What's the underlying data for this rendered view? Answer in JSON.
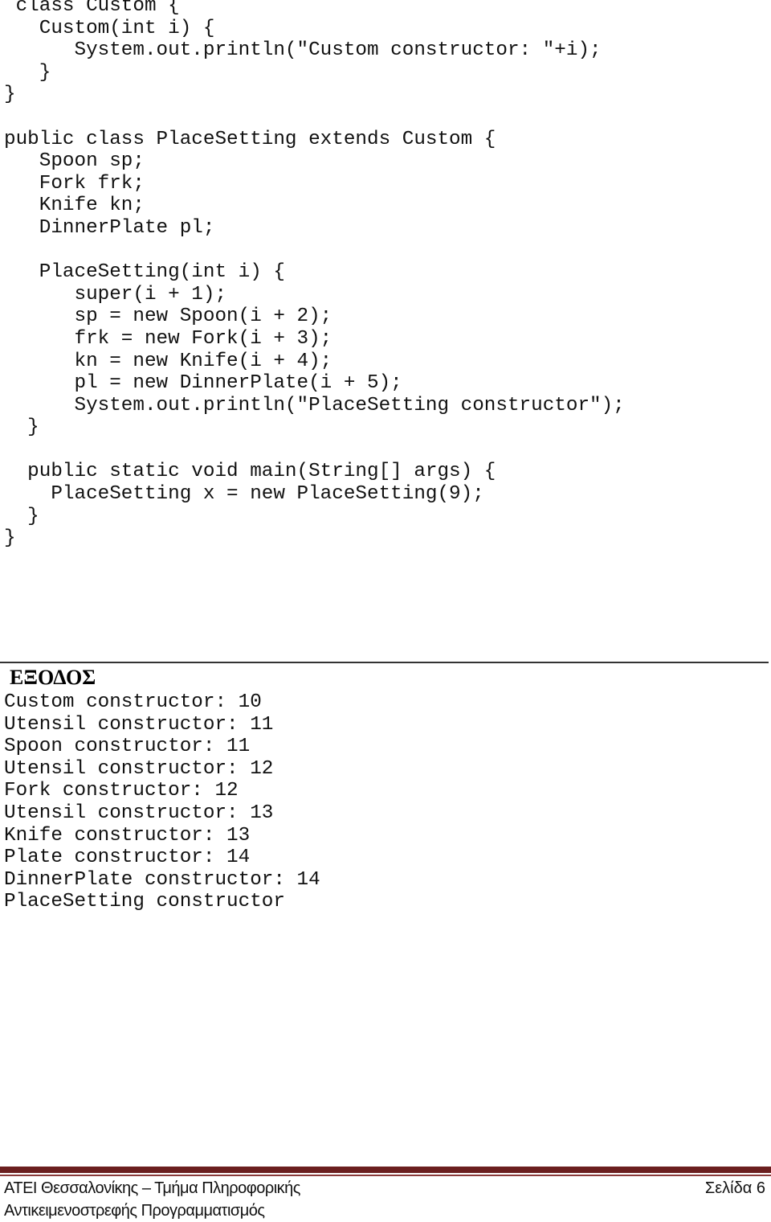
{
  "code": {
    "lines": [
      " class Custom {",
      "   Custom(int i) {",
      "      System.out.println(\"Custom constructor: \"+i);",
      "   }",
      "}",
      "",
      "public class PlaceSetting extends Custom {",
      "   Spoon sp;",
      "   Fork frk;",
      "   Knife kn;",
      "   DinnerPlate pl;",
      "",
      "   PlaceSetting(int i) {",
      "      super(i + 1);",
      "      sp = new Spoon(i + 2);",
      "      frk = new Fork(i + 3);",
      "      kn = new Knife(i + 4);",
      "      pl = new DinnerPlate(i + 5);",
      "      System.out.println(\"PlaceSetting constructor\");",
      "  }",
      "",
      "  public static void main(String[] args) {",
      "    PlaceSetting x = new PlaceSetting(9);",
      "  }",
      "}"
    ]
  },
  "output": {
    "title": "ΕΞΟΔΟΣ",
    "lines": [
      "Custom constructor: 10",
      "Utensil constructor: 11",
      "Spoon constructor: 11",
      "Utensil constructor: 12",
      "Fork constructor: 12",
      "Utensil constructor: 13",
      "Knife constructor: 13",
      "Plate constructor: 14",
      "DinnerPlate constructor: 14",
      "PlaceSetting constructor"
    ]
  },
  "footer": {
    "institution": "ΑΤΕΙ Θεσσαλονίκης – Τμήμα Πληροφορικής",
    "page_label": "Σελίδα 6",
    "course": "Αντικειμενοστρεφής Προγραμματισμός",
    "accent_color": "#6b1f1f"
  }
}
